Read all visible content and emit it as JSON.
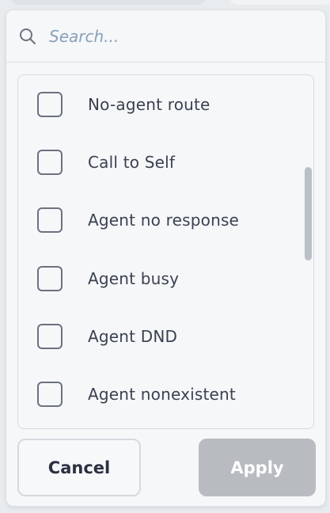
{
  "search": {
    "placeholder": "Search..."
  },
  "options": [
    {
      "label": "No-agent route",
      "checked": false
    },
    {
      "label": "Call to Self",
      "checked": false
    },
    {
      "label": "Agent no response",
      "checked": false
    },
    {
      "label": "Agent busy",
      "checked": false
    },
    {
      "label": "Agent DND",
      "checked": false
    },
    {
      "label": "Agent nonexistent",
      "checked": false
    }
  ],
  "actions": {
    "cancel_label": "Cancel",
    "apply_label": "Apply"
  },
  "colors": {
    "apply_disabled": "#b8bbbf",
    "checkbox_border": "#6b7280",
    "placeholder": "#8aa0b8"
  }
}
